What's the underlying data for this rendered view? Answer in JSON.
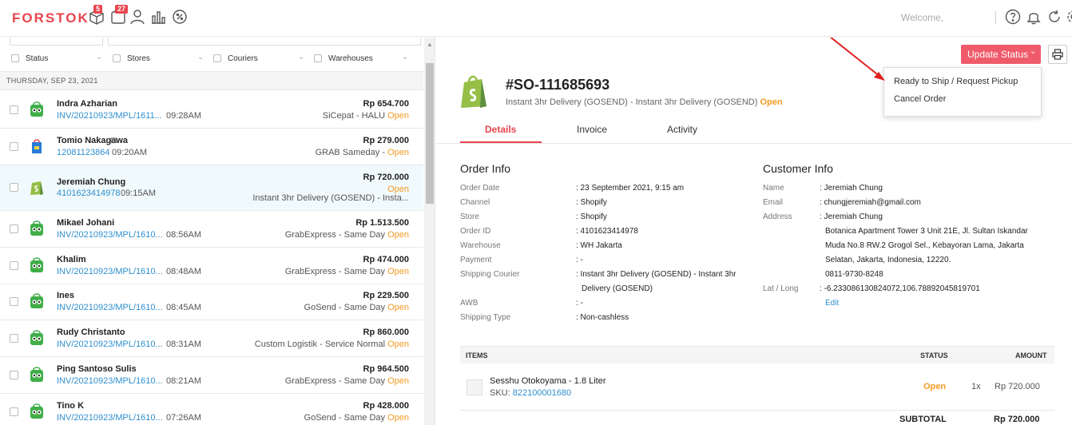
{
  "header": {
    "logo": "FORSTOK",
    "orders_badge": "5",
    "messages_badge": "27",
    "welcome": "Welcome,"
  },
  "filters": [
    {
      "label": "Status"
    },
    {
      "label": "Stores"
    },
    {
      "label": "Couriers"
    },
    {
      "label": "Warehouses"
    }
  ],
  "date_header": "THURSDAY, SEP 23, 2021",
  "orders": [
    {
      "name": "Indra Azharian",
      "ref": "INV/20210923/MPL/1611...",
      "time": "09:28AM",
      "amount": "Rp 654.700",
      "shipping": "SiCepat - HALU ",
      "status": "Open",
      "channel": "tokopedia"
    },
    {
      "name": "Tomio Nakagawa",
      "ref": "12081123864",
      "time": "09:20AM",
      "amount": "Rp 279.000",
      "shipping": "GRAB Sameday - ",
      "status": "Open",
      "channel": "bag"
    },
    {
      "name": "Jeremiah Chung",
      "ref": "4101623414978",
      "time": "09:15AM",
      "amount": "Rp 720.000",
      "shipping": "Instant 3hr Delivery (GOSEND) - Insta...",
      "status": "Open",
      "channel": "shopify"
    },
    {
      "name": "Mikael Johani",
      "ref": "INV/20210923/MPL/1610...",
      "time": "08:56AM",
      "amount": "Rp 1.513.500",
      "shipping": "GrabExpress - Same Day ",
      "status": "Open",
      "channel": "tokopedia"
    },
    {
      "name": "Khalim",
      "ref": "INV/20210923/MPL/1610...",
      "time": "08:48AM",
      "amount": "Rp 474.000",
      "shipping": "GrabExpress - Same Day ",
      "status": "Open",
      "channel": "tokopedia"
    },
    {
      "name": "Ines",
      "ref": "INV/20210923/MPL/1610...",
      "time": "08:45AM",
      "amount": "Rp 229.500",
      "shipping": "GoSend - Same Day ",
      "status": "Open",
      "channel": "tokopedia"
    },
    {
      "name": "Rudy Christanto",
      "ref": "INV/20210923/MPL/1610...",
      "time": "08:31AM",
      "amount": "Rp 860.000",
      "shipping": "Custom Logistik - Service Normal ",
      "status": "Open",
      "channel": "tokopedia"
    },
    {
      "name": "Ping Santoso Sulis",
      "ref": "INV/20210923/MPL/1610...",
      "time": "08:21AM",
      "amount": "Rp 964.500",
      "shipping": "GrabExpress - Same Day ",
      "status": "Open",
      "channel": "tokopedia"
    },
    {
      "name": "Tino K",
      "ref": "INV/20210923/MPL/1610...",
      "time": "07:26AM",
      "amount": "Rp 428.000",
      "shipping": "GoSend - Same Day ",
      "status": "Open",
      "channel": "tokopedia"
    }
  ],
  "detail": {
    "order_number": "#SO-111685693",
    "subtitle": "Instant 3hr Delivery (GOSEND) - Instant 3hr Delivery (GOSEND) ",
    "subtitle_status": "Open",
    "update_button": "Update Status",
    "dropdown": [
      "Ready to Ship / Request Pickup",
      "Cancel Order"
    ],
    "tabs": [
      "Details",
      "Invoice",
      "Activity"
    ],
    "order_info_title": "Order Info",
    "order_info": [
      {
        "label": "Order Date",
        "value": ": 23 September 2021, 9:15 am"
      },
      {
        "label": "Channel",
        "value": ": Shopify"
      },
      {
        "label": "Store",
        "value": ": Shopify"
      },
      {
        "label": "Order ID",
        "value": ": 4101623414978"
      },
      {
        "label": "Warehouse",
        "value": ": WH Jakarta"
      },
      {
        "label": "Payment",
        "value": ": -"
      },
      {
        "label": "Shipping Courier",
        "value": ": Instant 3hr Delivery (GOSEND) - Instant 3hr"
      },
      {
        "label": "",
        "value": "Delivery (GOSEND)"
      },
      {
        "label": "AWB",
        "value": ": -"
      },
      {
        "label": "Shipping Type",
        "value": ": Non-cashless"
      }
    ],
    "customer_info_title": "Customer Info",
    "customer_info": [
      {
        "label": "Name",
        "value": ": Jeremiah Chung"
      },
      {
        "label": "Email",
        "value": ": chungjeremiah@gmail.com"
      },
      {
        "label": "Address",
        "value": ": Jeremiah Chung"
      },
      {
        "label": "",
        "value": "Botanica Apartment Tower 3 Unit 21E, Jl. Sultan Iskandar"
      },
      {
        "label": "",
        "value": "Muda No.8 RW.2 Grogol Sel., Kebayoran Lama, Jakarta"
      },
      {
        "label": "",
        "value": "Selatan, Jakarta, Indonesia, 12220."
      },
      {
        "label": "",
        "value": "0811-9730-8248"
      },
      {
        "label": "Lat / Long",
        "value": ": -6.233086130824072,106.78892045819701"
      }
    ],
    "edit_link": "Edit",
    "items_header": {
      "items": "ITEMS",
      "status": "STATUS",
      "amount": "AMOUNT"
    },
    "item": {
      "name": "Sesshu Otokoyama - 1.8 Liter",
      "sku_label": "SKU: ",
      "sku": "822100001680",
      "status": "Open",
      "qty": "1x",
      "amount": "Rp 720.000"
    },
    "subtotal_label": "SUBTOTAL",
    "subtotal_amount": "Rp 720.000"
  },
  "colors": {
    "brand": "#e8454e",
    "link": "#2f8fcf",
    "open": "#f59a23"
  }
}
